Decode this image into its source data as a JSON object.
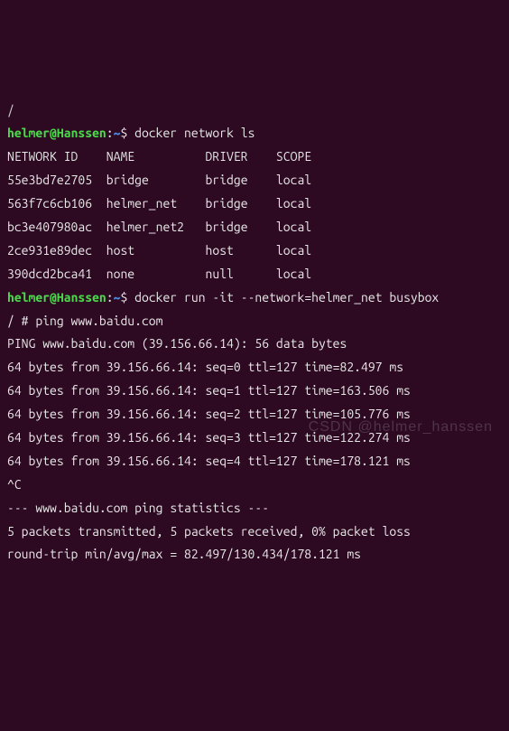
{
  "line0": "/",
  "prompt1": {
    "user": "helmer",
    "at": "@",
    "host": "Hanssen",
    "colon": ":",
    "path": "~",
    "dollar": "$ ",
    "cmd": "docker network ls"
  },
  "table": {
    "header": {
      "id": "NETWORK ID",
      "name": "NAME",
      "driver": "DRIVER",
      "scope": "SCOPE"
    },
    "rows": [
      {
        "id": "55e3bd7e2705",
        "name": "bridge",
        "driver": "bridge",
        "scope": "local"
      },
      {
        "id": "563f7c6cb106",
        "name": "helmer_net",
        "driver": "bridge",
        "scope": "local"
      },
      {
        "id": "bc3e407980ac",
        "name": "helmer_net2",
        "driver": "bridge",
        "scope": "local"
      },
      {
        "id": "2ce931e89dec",
        "name": "host",
        "driver": "host",
        "scope": "local"
      },
      {
        "id": "390dcd2bca41",
        "name": "none",
        "driver": "null",
        "scope": "local"
      }
    ]
  },
  "prompt2": {
    "user": "helmer",
    "at": "@",
    "host": "Hanssen",
    "colon": ":",
    "path": "~",
    "dollar": "$ ",
    "cmd": "docker run -it --network=helmer_net busybox"
  },
  "shellLine": "/ # ping www.baidu.com",
  "pingHeader": "PING www.baidu.com (39.156.66.14): 56 data bytes",
  "pings": [
    "64 bytes from 39.156.66.14: seq=0 ttl=127 time=82.497 ms",
    "64 bytes from 39.156.66.14: seq=1 ttl=127 time=163.506 ms",
    "64 bytes from 39.156.66.14: seq=2 ttl=127 time=105.776 ms",
    "64 bytes from 39.156.66.14: seq=3 ttl=127 time=122.274 ms",
    "64 bytes from 39.156.66.14: seq=4 ttl=127 time=178.121 ms"
  ],
  "ctrlC": "^C",
  "statsHeader": "--- www.baidu.com ping statistics ---",
  "statsLine1": "5 packets transmitted, 5 packets received, 0% packet loss",
  "statsLine2": "round-trip min/avg/max = 82.497/130.434/178.121 ms",
  "watermark": "CSDN @helmer_hanssen"
}
